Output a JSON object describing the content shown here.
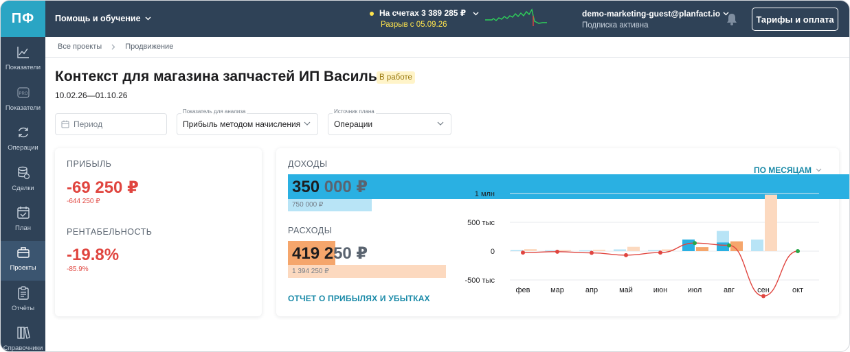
{
  "app": {
    "logo": "ПФ"
  },
  "sidebar": {
    "items": [
      {
        "label": "Показатели",
        "icon": "chart-line-icon"
      },
      {
        "label": "Показатели",
        "icon": "pro-icon"
      },
      {
        "label": "Операции",
        "icon": "refresh-icon"
      },
      {
        "label": "Сделки",
        "icon": "database-icon"
      },
      {
        "label": "План",
        "icon": "calendar-check-icon"
      },
      {
        "label": "Проекты",
        "icon": "briefcase-icon",
        "active": true
      },
      {
        "label": "Отчёты",
        "icon": "clipboard-icon"
      },
      {
        "label": "Справочники",
        "icon": "books-icon"
      }
    ]
  },
  "topbar": {
    "help": "Помощь и обучение",
    "balance_label": "На счетах 3 389 285 ₽",
    "gap_label": "Разрыв с 05.09.26",
    "user_email": "demo-marketing-guest@planfact.io",
    "subscription": "Подписка активна",
    "tariff_button": "Тарифы и оплата"
  },
  "breadcrumb": {
    "root": "Все проекты",
    "current": "Продвижение"
  },
  "project": {
    "title": "Контекст для магазина запчастей ИП Васильев",
    "status": "В работе",
    "dates": "10.02.26—01.10.26"
  },
  "filters": {
    "period_placeholder": "Период",
    "indicator_label": "Показатель для анализа",
    "indicator_value": "Прибыль методом начисления",
    "source_label": "Источник плана",
    "source_value": "Операции"
  },
  "profit_card": {
    "profit_caption": "ПРИБЫЛЬ",
    "profit_value": "-69 250 ₽",
    "profit_plan": "-644 250 ₽",
    "margin_caption": "РЕНТАБЕЛЬНОСТЬ",
    "margin_value": "-19.8%",
    "margin_plan": "-85.9%"
  },
  "income_card": {
    "income_caption": "ДОХОДЫ",
    "income_value_a": "350 ",
    "income_value_b": "000 ₽",
    "income_plan": "750 000 ₽",
    "income_fraction": 0.467,
    "expense_caption": "РАСХОДЫ",
    "expense_value_a": "419 2",
    "expense_value_b": "50 ₽",
    "expense_plan": "1 394 250 ₽",
    "expense_fraction": 0.301,
    "report_link": "ОТЧЕТ О ПРИБЫЛЯХ И УБЫТКАХ",
    "period_switch": "ПО МЕСЯЦАМ"
  },
  "colors": {
    "income": "#2ab0e2",
    "income_plan": "#b8e4f6",
    "expense": "#f5a66c",
    "expense_plan": "#fcd9bf",
    "profit_neg": "#e0453f",
    "profit_pos": "#2aa64a",
    "sidebar": "#2f4257",
    "logo": "#2aa5c4"
  },
  "chart_data": {
    "type": "bar",
    "categories": [
      "фев",
      "мар",
      "апр",
      "май",
      "июн",
      "июл",
      "авг",
      "сен",
      "окт"
    ],
    "y_tick_labels": [
      "1 млн",
      "500 тыс",
      "0",
      "-500 тыс"
    ],
    "y_ticks": [
      1000000,
      500000,
      0,
      -500000
    ],
    "ylim": [
      -500000,
      1000000
    ],
    "series": [
      {
        "values": [
          0,
          0,
          0,
          0,
          0,
          200000,
          150000,
          0,
          0
        ]
      },
      {
        "values": [
          20000,
          15000,
          15000,
          30000,
          20000,
          200000,
          350000,
          200000,
          0
        ]
      },
      {
        "values": [
          0,
          0,
          0,
          0,
          0,
          70000,
          170000,
          0,
          0
        ]
      },
      {
        "values": [
          35000,
          20000,
          25000,
          75000,
          30000,
          50000,
          160000,
          980000,
          0
        ]
      },
      {
        "values": [
          -25000,
          -10000,
          -30000,
          -70000,
          -25000,
          140000,
          100000,
          -780000,
          0
        ]
      }
    ]
  }
}
